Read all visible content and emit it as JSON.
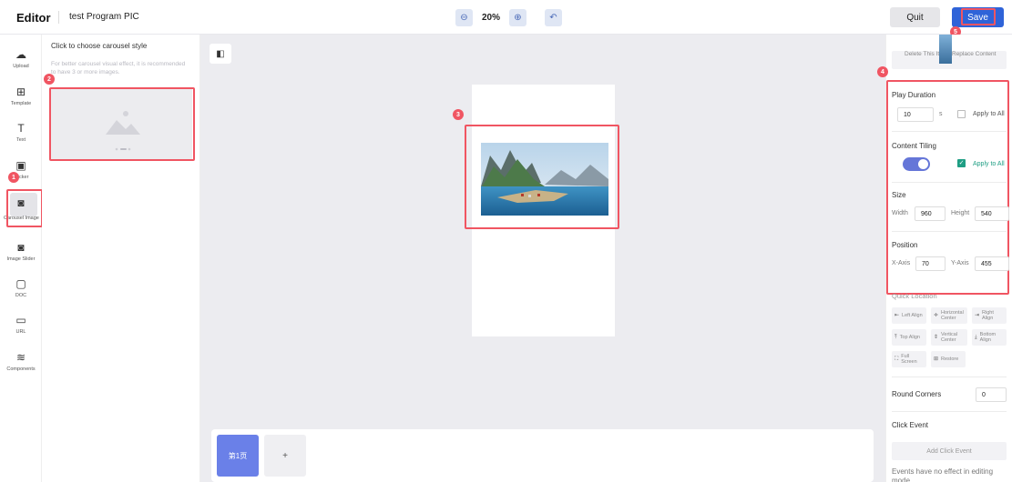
{
  "header": {
    "brand": "Editor",
    "project_title": "test Program PIC",
    "zoom": "20%",
    "quit_label": "Quit",
    "save_label": "Save"
  },
  "sidebar": {
    "items": [
      {
        "label": "Upload",
        "icon": "upload-icon"
      },
      {
        "label": "Template",
        "icon": "template-icon"
      },
      {
        "label": "Text",
        "icon": "text-icon"
      },
      {
        "label": "Sticker",
        "icon": "sticker-icon"
      },
      {
        "label": "Carousel Image",
        "icon": "carousel-image-icon"
      },
      {
        "label": "Image Slider",
        "icon": "image-slider-icon"
      },
      {
        "label": "DOC",
        "icon": "doc-icon"
      },
      {
        "label": "URL",
        "icon": "url-icon"
      },
      {
        "label": "Components",
        "icon": "components-icon"
      }
    ]
  },
  "style_panel": {
    "heading": "Click to choose carousel style",
    "hint": "For better carousel visual effect, it is recommended to have 3 or more images."
  },
  "canvas": {
    "pages": [
      "第1页"
    ],
    "add_page": "+"
  },
  "properties": {
    "item_actions": {
      "delete": "Delete This Item",
      "replace": "Replace Content"
    },
    "play_duration": {
      "label": "Play Duration",
      "value": "10",
      "unit": "s",
      "apply_all": "Apply to All",
      "apply_checked": false
    },
    "content_tiling": {
      "label": "Content Tiling",
      "enabled": true,
      "apply_all": "Apply to All",
      "apply_checked": true
    },
    "size": {
      "label": "Size",
      "width_label": "Width",
      "width": "960",
      "height_label": "Height",
      "height": "540"
    },
    "position": {
      "label": "Position",
      "x_label": "X-Axis",
      "x": "70",
      "y_label": "Y-Axis",
      "y": "455"
    },
    "quick_location": {
      "label": "Quick Location",
      "buttons": [
        "Left Align",
        "Horizontal Center",
        "Right Align",
        "Top Align",
        "Vertical Center",
        "Bottom Align",
        "Full Screen",
        "Restore"
      ]
    },
    "round_corners": {
      "label": "Round Corners",
      "value": "0"
    },
    "click_event": {
      "label": "Click Event",
      "add_label": "Add Click Event",
      "note": "Events have no effect in editing mode"
    }
  },
  "annotations": [
    "1",
    "2",
    "3",
    "4",
    "5"
  ],
  "colors": {
    "primary": "#2f63d8",
    "highlight": "#f05562",
    "page_tab": "#6a80e8",
    "toggle": "#6576d8",
    "checkbox": "#1f9e84"
  }
}
